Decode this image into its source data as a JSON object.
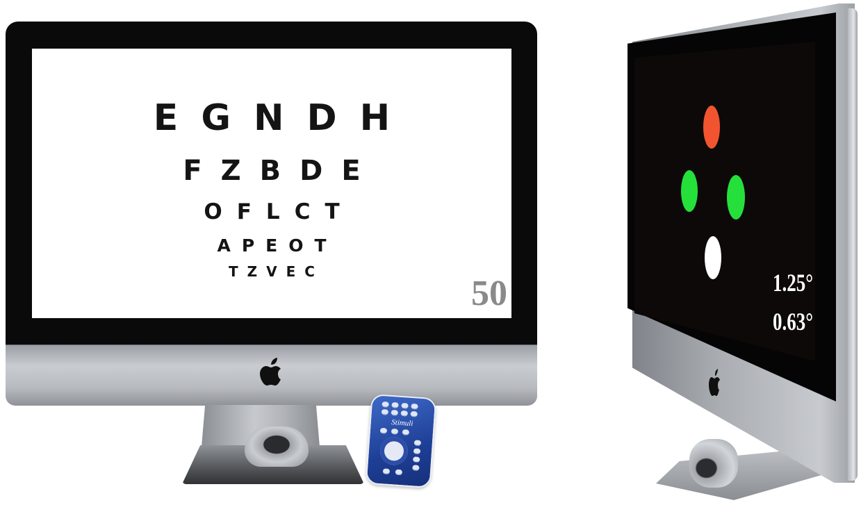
{
  "front_monitor": {
    "eye_chart_rows": [
      "EGNDH",
      "FZBDE",
      "OFLCT",
      "APEOT",
      "TZVEC"
    ],
    "size_indicator": "50",
    "logo": "apple-logo"
  },
  "remote": {
    "label": "Stimuli"
  },
  "side_monitor": {
    "stimulus_dots": [
      {
        "color": "#f2542f",
        "name": "red"
      },
      {
        "color": "#25e03a",
        "name": "green-left"
      },
      {
        "color": "#25e03a",
        "name": "green-right"
      },
      {
        "color": "#ffffff",
        "name": "white"
      }
    ],
    "angle_values": [
      "1.25°",
      "0.63°"
    ],
    "logo": "apple-logo"
  }
}
